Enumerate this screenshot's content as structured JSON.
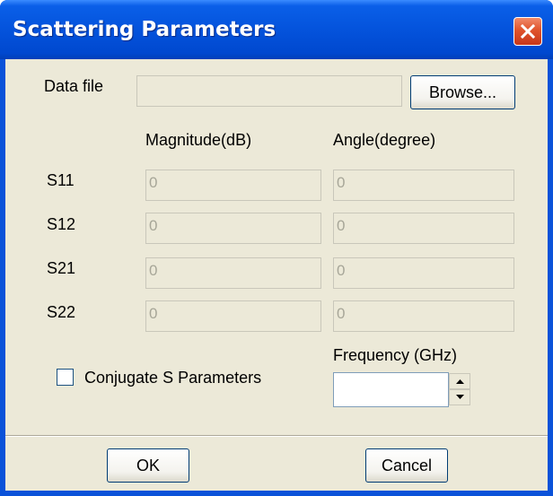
{
  "window": {
    "title": "Scattering Parameters"
  },
  "data_file": {
    "label": "Data file",
    "value": "",
    "browse_label": "Browse..."
  },
  "columns": {
    "magnitude": "Magnitude(dB)",
    "angle": "Angle(degree)"
  },
  "rows": [
    {
      "label": "S11",
      "magnitude": "0",
      "angle": "0"
    },
    {
      "label": "S12",
      "magnitude": "0",
      "angle": "0"
    },
    {
      "label": "S21",
      "magnitude": "0",
      "angle": "0"
    },
    {
      "label": "S22",
      "magnitude": "0",
      "angle": "0"
    }
  ],
  "conjugate": {
    "label": "Conjugate S Parameters",
    "checked": false
  },
  "frequency": {
    "label": "Frequency (GHz)",
    "value": ""
  },
  "buttons": {
    "ok": "OK",
    "cancel": "Cancel"
  },
  "icons": {
    "close": "close-icon",
    "spin_up": "spin-up-icon",
    "spin_down": "spin-down-icon"
  }
}
